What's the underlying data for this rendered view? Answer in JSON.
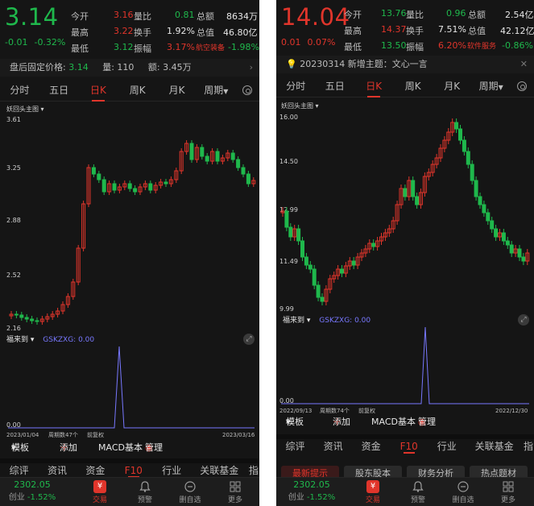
{
  "left": {
    "price": "3.14",
    "change": "-0.01",
    "change_pct": "-0.32%",
    "stats": [
      {
        "label": "今开",
        "value": "3.16",
        "label2": "量比",
        "value2": "0.81",
        "label3": "总额",
        "value3": "8634万"
      },
      {
        "label": "最高",
        "value": "3.22",
        "label2": "换手",
        "value2": "1.92%",
        "label3": "总值",
        "value3": "46.80亿"
      },
      {
        "label": "最低",
        "value": "3.12",
        "label2": "振幅",
        "value2": "3.17%",
        "label3": "航空装备",
        "value3": "-1.98%"
      }
    ],
    "infobar": {
      "fixed_label": "盘后固定价格:",
      "fixed_value": "3.14",
      "volume": "量: 110",
      "amount": "额: 3.45万"
    },
    "tabs": [
      "分时",
      "五日",
      "日K",
      "周K",
      "月K",
      "周期"
    ],
    "active_tab": "日K",
    "overlay_label": "妖回头主图",
    "axis": {
      "top": "3.61",
      "y1": "3.25",
      "y2": "2.88",
      "y3": "2.52",
      "bottom": "2.16"
    },
    "indicator": {
      "name": "福来到",
      "gsk_label": "GSKZXG: 0.00"
    },
    "sub_axis": {
      "bottom": "0.00"
    },
    "date_row": {
      "start": "2023/01/04",
      "cycles": "周期数47个",
      "adj": "前复权",
      "end": "2023/03/16"
    },
    "toolrow": {
      "template": "模板",
      "add": "添加",
      "macd": "MACD基本",
      "manage": "管理"
    },
    "subtabs": [
      "综评",
      "资讯",
      "资金",
      "F10",
      "行业",
      "关联基金",
      "指"
    ],
    "active_subtab": "F10",
    "index": {
      "value": "2302.05",
      "name": "创业",
      "pct": "-1.52%"
    },
    "nav": [
      "交易",
      "预警",
      "删自选",
      "更多"
    ]
  },
  "right": {
    "price": "14.04",
    "change": "0.01",
    "change_pct": "0.07%",
    "stats": [
      {
        "label": "今开",
        "value": "13.76",
        "label2": "量比",
        "value2": "0.96",
        "label3": "总额",
        "value3": "2.54亿"
      },
      {
        "label": "最高",
        "value": "14.37",
        "label2": "换手",
        "value2": "7.51%",
        "label3": "总值",
        "value3": "42.12亿"
      },
      {
        "label": "最低",
        "value": "13.50",
        "label2": "振幅",
        "value2": "6.20%",
        "label3": "软件服务",
        "value3": "-0.86%"
      }
    ],
    "notice": "20230314 新增主题：文心一言",
    "tabs": [
      "分时",
      "五日",
      "日K",
      "周K",
      "月K",
      "周期"
    ],
    "active_tab": "日K",
    "overlay_label": "妖回头主图",
    "axis": {
      "top": "16.00",
      "y1": "14.50",
      "y2": "12.99",
      "y3": "11.49",
      "bottom": "9.99"
    },
    "indicator": {
      "name": "福来到",
      "gsk_label": "GSKZXG: 0.00"
    },
    "sub_axis": {
      "bottom": "0.00"
    },
    "date_row": {
      "start": "2022/09/13",
      "cycles": "周期数74个",
      "adj": "前复权",
      "end": "2022/12/30"
    },
    "toolrow": {
      "template": "模板",
      "add": "添加",
      "macd": "MACD基本",
      "manage": "管理"
    },
    "subtabs": [
      "综评",
      "资讯",
      "资金",
      "F10",
      "行业",
      "关联基金",
      "指"
    ],
    "active_subtab": "F10",
    "f10_chips": [
      "最新提示",
      "股东股本",
      "财务分析",
      "热点题材"
    ],
    "index": {
      "value": "2302.05",
      "name": "创业",
      "pct": "-1.52%"
    },
    "nav": [
      "交易",
      "预警",
      "删自选",
      "更多"
    ]
  },
  "colors": {
    "up": "#e0352b",
    "down": "#1fb84c",
    "bg": "#151515",
    "indicator": "#7878ff"
  }
}
